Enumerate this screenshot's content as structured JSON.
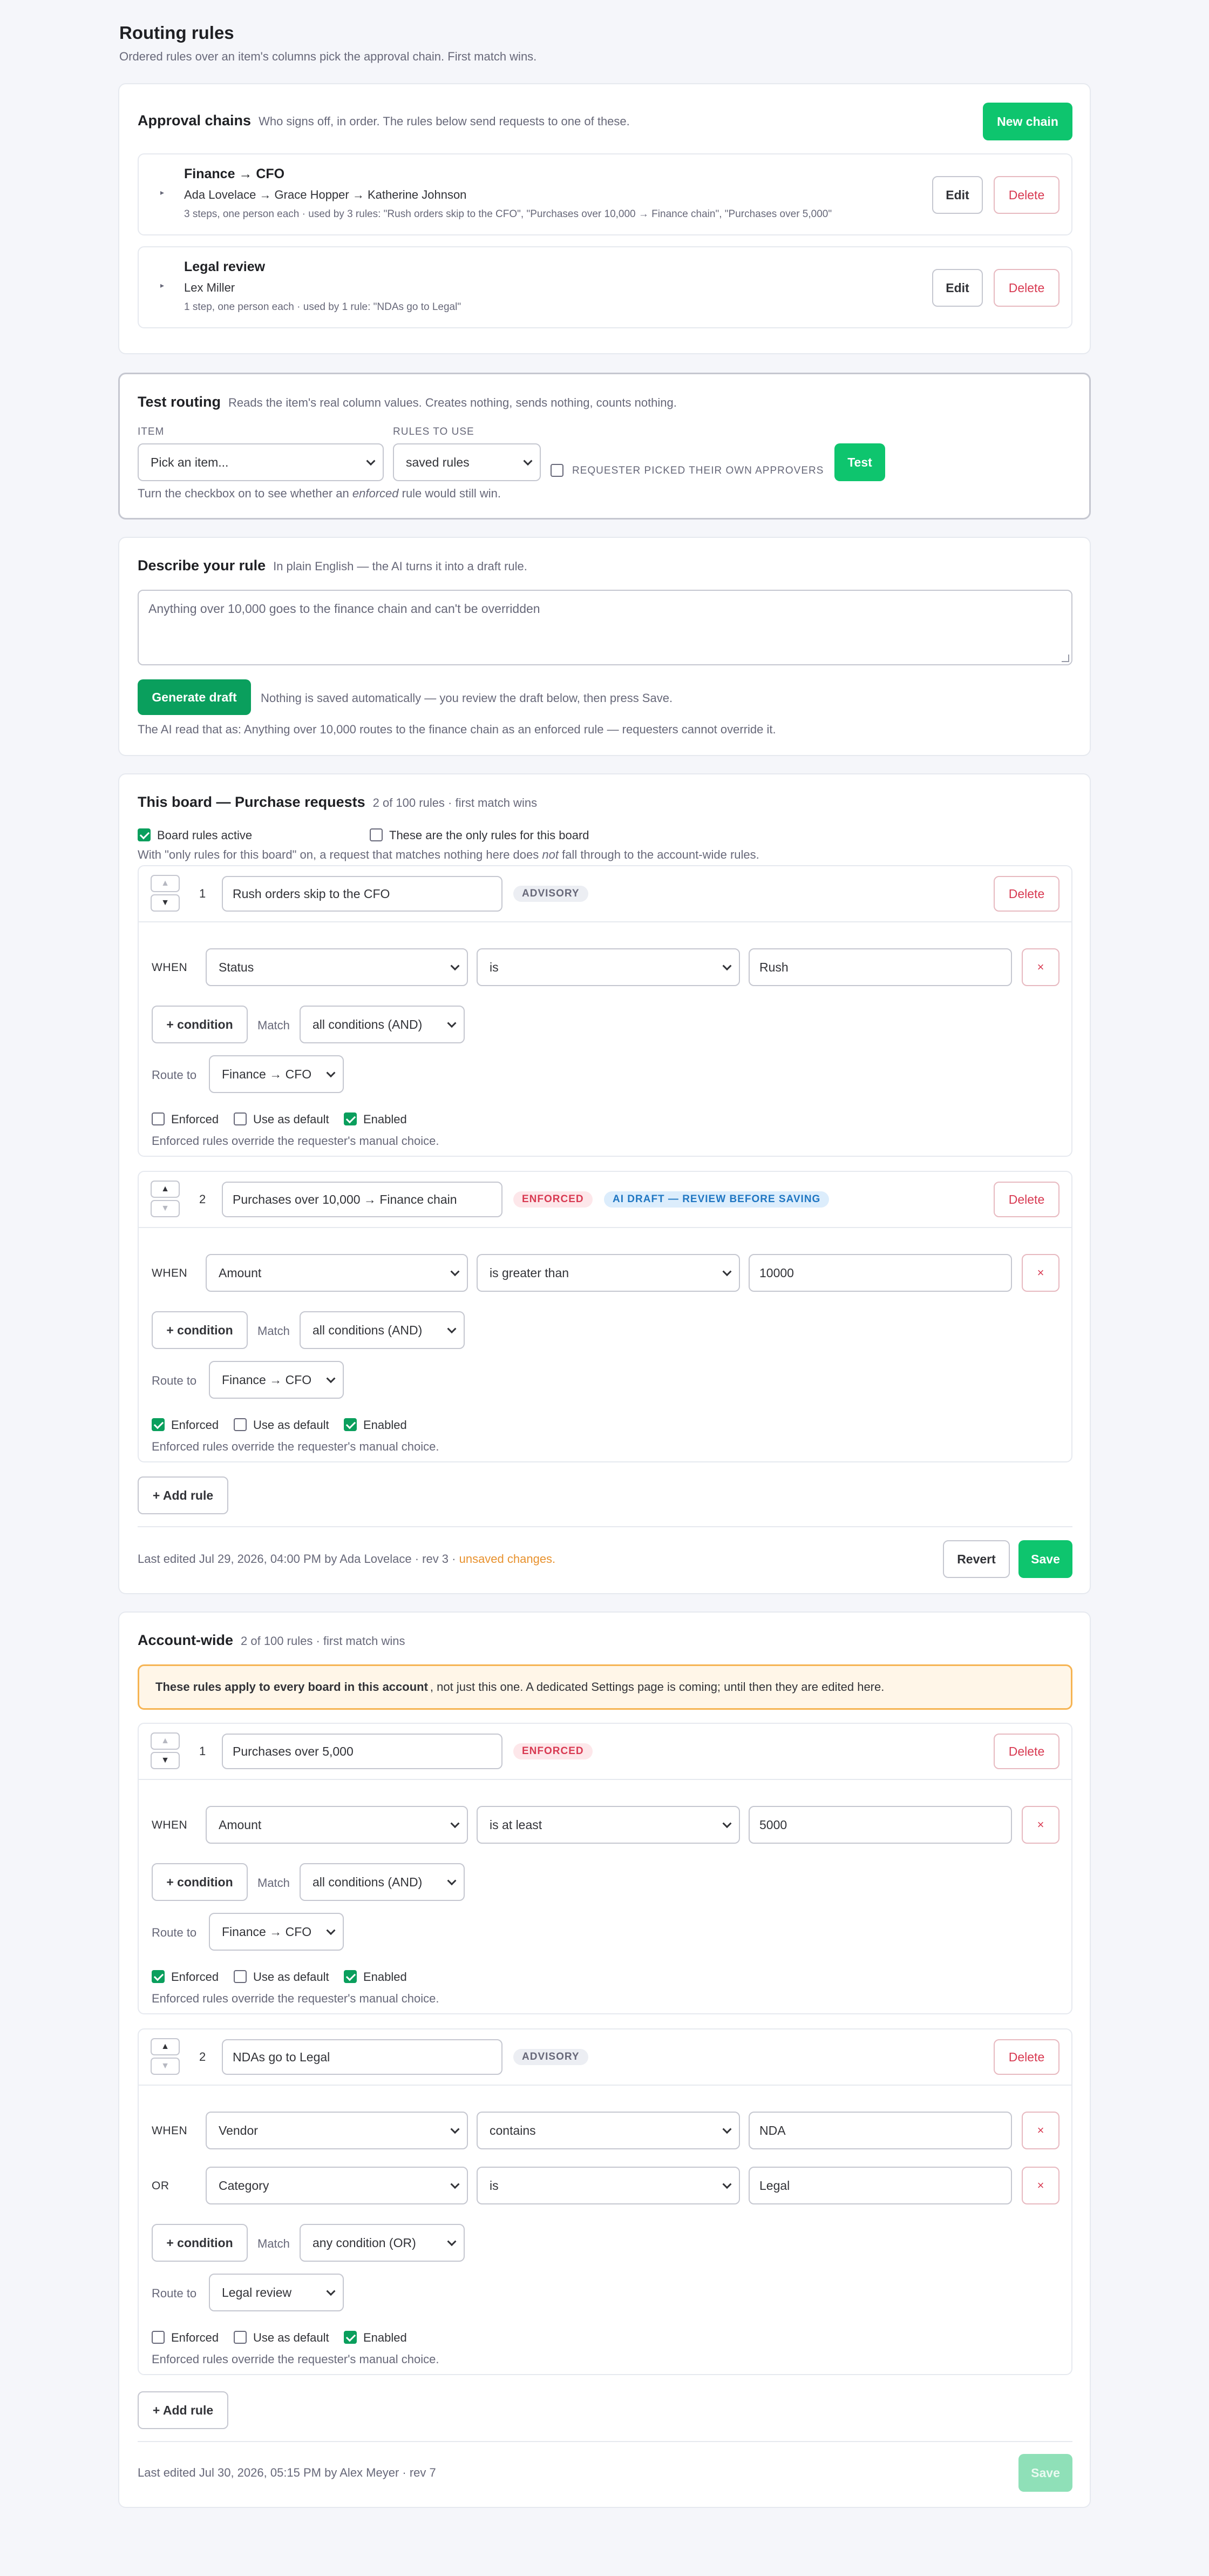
{
  "page": {
    "title": "Routing rules",
    "subtitle": "Ordered rules over an item's columns pick the approval chain. First match wins."
  },
  "chains": {
    "title": "Approval chains",
    "hint": "Who signs off, in order. The rules below send requests to one of these.",
    "new_label": "New chain",
    "edit_label": "Edit",
    "delete_label": "Delete",
    "items": [
      {
        "name": "Finance → CFO",
        "people": "Ada Lovelace → Grace Hopper → Katherine Johnson",
        "meta": "3 steps, one person each · used by 3 rules: \"Rush orders skip to the CFO\", \"Purchases over 10,000 → Finance chain\", \"Purchases over 5,000\""
      },
      {
        "name": "Legal review",
        "people": "Lex Miller",
        "meta": "1 step, one person each · used by 1 rule: \"NDAs go to Legal\""
      }
    ]
  },
  "test": {
    "title": "Test routing",
    "hint": "Reads the item's real column values. Creates nothing, sends nothing, counts nothing.",
    "item_label": "ITEM",
    "item_value": "Pick an item...",
    "rules_label": "RULES TO USE",
    "rules_value": "saved rules",
    "requester_label": "REQUESTER PICKED THEIR OWN APPROVERS",
    "test_button": "Test",
    "note_before": "Turn the checkbox on to see whether an ",
    "note_em": "enforced",
    "note_after": " rule would still win."
  },
  "describe": {
    "title": "Describe your rule",
    "hint": "In plain English — the AI turns it into a draft rule.",
    "text": "Anything over 10,000 goes to the finance chain and can't be overridden",
    "generate_label": "Generate draft",
    "generate_note": "Nothing is saved automatically — you review the draft below, then press Save.",
    "ai_read": "The AI read that as: Anything over 10,000 routes to the finance chain as an enforced rule — requesters cannot override it."
  },
  "common": {
    "delete": "Delete",
    "x": "×",
    "when": "WHEN",
    "or": "OR",
    "add_condition": "+ condition",
    "match": "Match",
    "route_to": "Route to",
    "enforced": "Enforced",
    "use_default": "Use as default",
    "enabled": "Enabled",
    "override_note": "Enforced rules override the requester's manual choice.",
    "add_rule": "+ Add rule",
    "revert": "Revert",
    "save": "Save",
    "up": "▲",
    "down": "▼"
  },
  "board": {
    "title": "This board — Purchase requests",
    "hint": "2 of 100 rules · first match wins",
    "active_label": "Board rules active",
    "only_label": "These are the only rules for this board",
    "note_before": "With \"only rules for this board\" on, a request that matches nothing here does ",
    "note_em": "not",
    "note_after": " fall through to the account-wide rules.",
    "rules": [
      {
        "num": "1",
        "name": "Rush orders skip to the CFO",
        "badge": "ADVISORY",
        "field": "Status",
        "op": "is",
        "value": "Rush",
        "match": "all conditions (AND)",
        "route": "Finance → CFO"
      },
      {
        "num": "2",
        "name": "Purchases over 10,000 → Finance chain",
        "badge": "ENFORCED",
        "badge2": "AI DRAFT — REVIEW BEFORE SAVING",
        "field": "Amount",
        "op": "is greater than",
        "value": "10000",
        "match": "all conditions (AND)",
        "route": "Finance → CFO"
      }
    ],
    "footer": "Last edited Jul 29, 2026, 04:00 PM by Ada Lovelace · rev 3 · ",
    "unsaved": "unsaved changes."
  },
  "account": {
    "title": "Account-wide",
    "hint": "2 of 100 rules · first match wins",
    "warn_bold": "These rules apply to every board in this account",
    "warn_rest": ", not just this one. A dedicated Settings page is coming; until then they are edited here.",
    "rules": [
      {
        "num": "1",
        "name": "Purchases over 5,000",
        "badge": "ENFORCED",
        "field": "Amount",
        "op": "is at least",
        "value": "5000",
        "match": "all conditions (AND)",
        "route": "Finance → CFO"
      },
      {
        "num": "2",
        "name": "NDAs go to Legal",
        "badge": "ADVISORY",
        "field": "Vendor",
        "op": "contains",
        "value": "NDA",
        "field2": "Category",
        "op2": "is",
        "value2": "Legal",
        "match": "any condition (OR)",
        "route": "Legal review"
      }
    ],
    "footer": "Last edited Jul 30, 2026, 05:15 PM by Alex Meyer · rev 7"
  },
  "colors": {
    "accent": "#0ec56e",
    "danger": "#d83a52",
    "warning": "#e8912d",
    "info": "#1f76c2"
  }
}
